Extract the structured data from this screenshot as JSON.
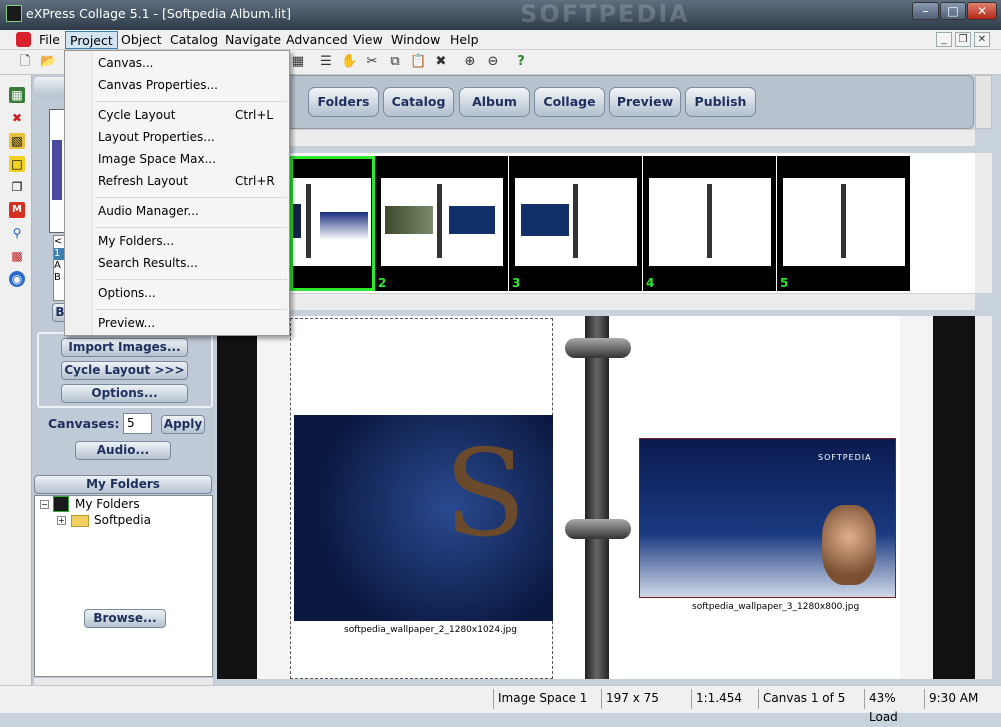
{
  "window": {
    "title": "eXPress Collage 5.1 - [Softpedia Album.lit]",
    "watermark": "SOFTPEDIA"
  },
  "menubar": {
    "items": [
      "File",
      "Project",
      "Object",
      "Catalog",
      "Navigate",
      "Advanced",
      "View",
      "Window",
      "Help"
    ],
    "active": "Project"
  },
  "project_menu": {
    "items": [
      {
        "label": "Canvas...",
        "shortcut": ""
      },
      {
        "label": "Canvas Properties...",
        "shortcut": ""
      },
      {
        "label": "Cycle Layout",
        "shortcut": "Ctrl+L"
      },
      {
        "label": "Layout Properties...",
        "shortcut": ""
      },
      {
        "label": "Image Space Max...",
        "shortcut": ""
      },
      {
        "label": "Refresh Layout",
        "shortcut": "Ctrl+R"
      },
      {
        "label": "Audio Manager...",
        "shortcut": ""
      },
      {
        "label": "My Folders...",
        "shortcut": ""
      },
      {
        "label": "Search Results...",
        "shortcut": ""
      },
      {
        "label": "Options...",
        "shortcut": ""
      },
      {
        "label": "Preview...",
        "shortcut": ""
      }
    ]
  },
  "nav_tabs": [
    "Folders",
    "Catalog",
    "Album",
    "Collage",
    "Preview",
    "Publish"
  ],
  "side_panel": {
    "import_images": "Import Images...",
    "cycle_layout": "Cycle Layout >>>",
    "options": "Options...",
    "canvases_label": "Canvases:",
    "canvases_value": "5",
    "apply": "Apply",
    "audio": "Audio...",
    "my_folders_header": "My Folders",
    "tree_root": "My Folders",
    "tree_child": "Softpedia",
    "browse": "Browse...",
    "partial_button": "B",
    "partial_list": [
      "<",
      "1",
      "A",
      "B"
    ]
  },
  "filmstrip": {
    "page_numbers": [
      "2",
      "3",
      "4",
      "5"
    ],
    "selected_index": 0
  },
  "canvas": {
    "image1_caption": "softpedia_wallpaper_2_1280x1024.jpg",
    "image2_caption": "softpedia_wallpaper_3_1280x800.jpg",
    "wallpaper2_text": "SOFTPEDIA"
  },
  "statusbar": {
    "image_space": "Image Space 1",
    "size": "197 x 75",
    "ratio": "1:1.454",
    "canvas": "Canvas 1 of 5",
    "load": "43% Load",
    "time": "9:30 AM"
  },
  "colors": {
    "accent": "#3c7fb1",
    "selected_frame": "#2ee82e",
    "nav_text": "#1f2f5e"
  }
}
